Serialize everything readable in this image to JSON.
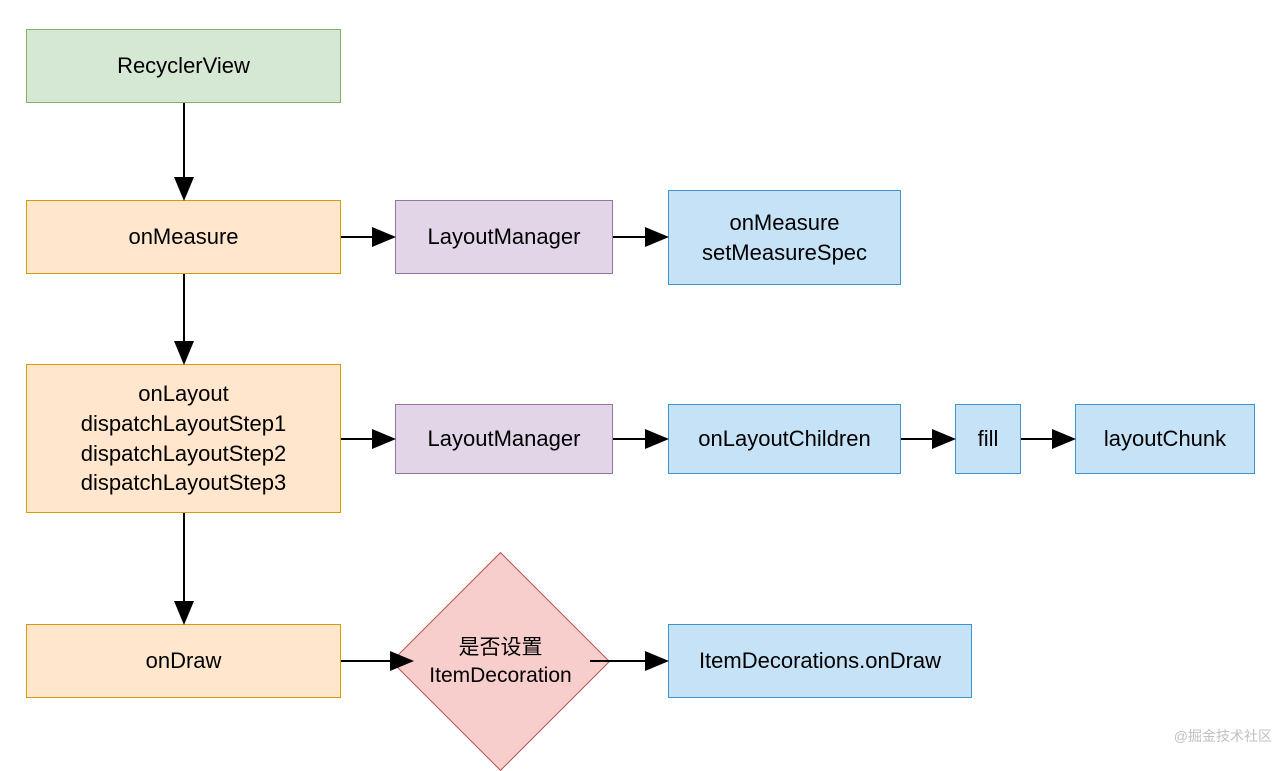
{
  "nodes": {
    "recyclerview": "RecyclerView",
    "onMeasure": "onMeasure",
    "layoutManager1": "LayoutManager",
    "onMeasureSpec": "onMeasure\nsetMeasureSpec",
    "onLayout": "onLayout\ndispatchLayoutStep1\ndispatchLayoutStep2\ndispatchLayoutStep3",
    "layoutManager2": "LayoutManager",
    "onLayoutChildren": "onLayoutChildren",
    "fill": "fill",
    "layoutChunk": "layoutChunk",
    "onDraw": "onDraw",
    "decision": "是否设置\nItemDecoration",
    "itemDecorationsOnDraw": "ItemDecorations.onDraw"
  },
  "watermark": "@掘金技术社区"
}
